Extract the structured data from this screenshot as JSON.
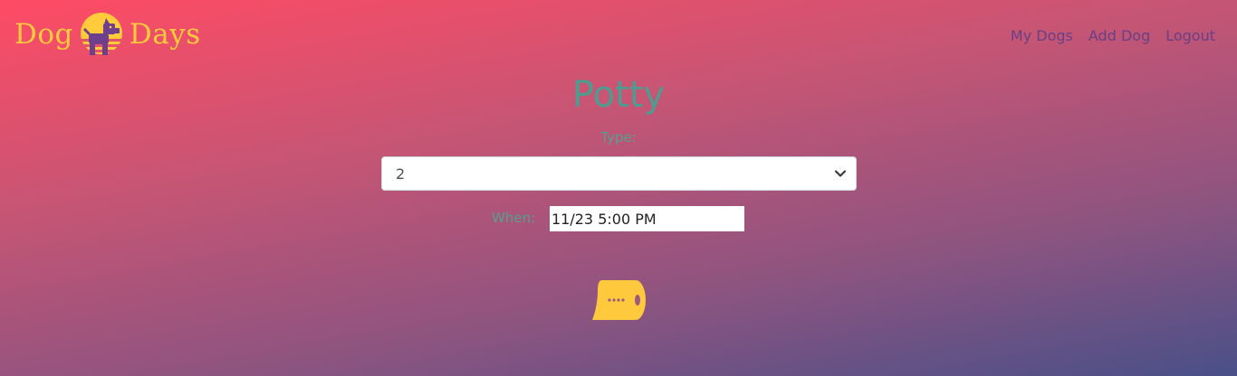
{
  "brand": {
    "word_left": "Dog",
    "word_right": "Days",
    "logo_icon": "dog-sun-icon",
    "brand_color": "#ffcb3b"
  },
  "nav": {
    "items": [
      {
        "label": "My Dogs"
      },
      {
        "label": "Add Dog"
      },
      {
        "label": "Logout"
      }
    ]
  },
  "page": {
    "title": "Potty"
  },
  "form": {
    "type_label": "Type:",
    "type_value": "2",
    "when_label": "When:",
    "when_value": "11/23 5:00 PM"
  },
  "icons": {
    "select_caret": "chevron-down-icon",
    "potty_icon": "toilet-paper-icon"
  },
  "colors": {
    "gradient_top": "#ff4b64",
    "gradient_bottom": "#4a5088",
    "title_color": "#4e9c8f",
    "nav_color": "#6a3f84"
  }
}
